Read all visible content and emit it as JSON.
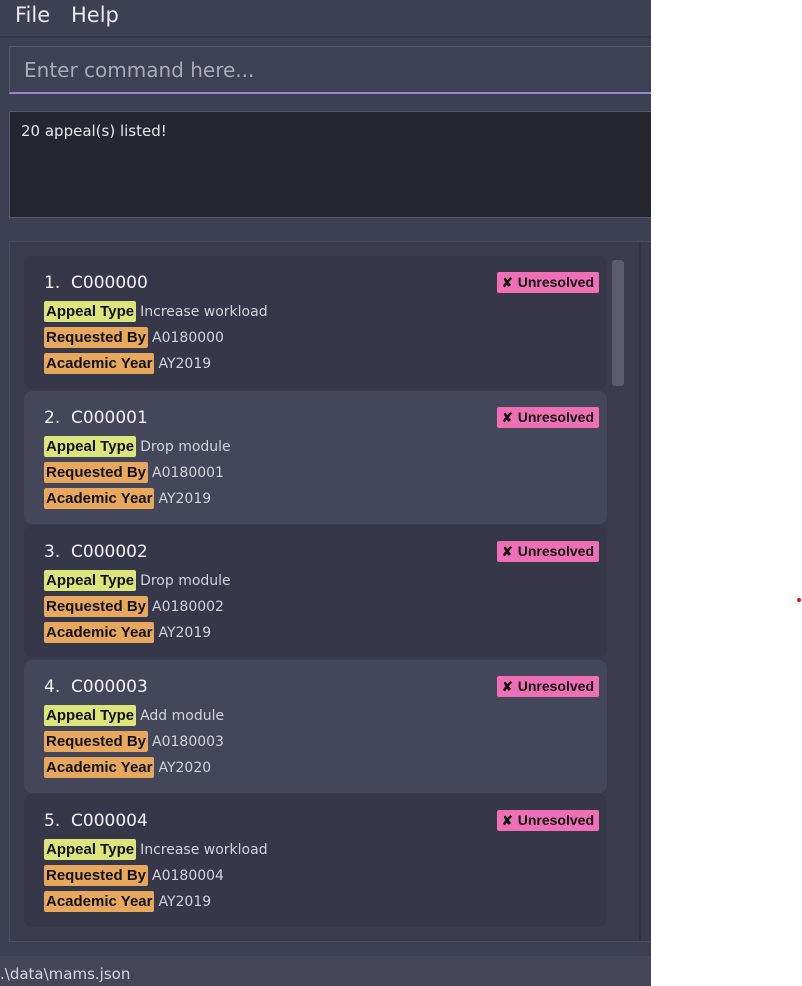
{
  "menu": {
    "file_label": "File",
    "help_label": "Help"
  },
  "command": {
    "placeholder": "Enter command here..."
  },
  "result": {
    "text": "20 appeal(s) listed!"
  },
  "labels": {
    "appeal_type": "Appeal Type",
    "requested_by": "Requested By",
    "academic_year": "Academic Year"
  },
  "status_icon": "✘",
  "appeals": [
    {
      "title": "1.  C000000",
      "status": "Unresolved",
      "appeal_type": "Increase workload",
      "requested_by": "A0180000",
      "academic_year": "AY2019"
    },
    {
      "title": "2.  C000001",
      "status": "Unresolved",
      "appeal_type": "Drop module",
      "requested_by": "A0180001",
      "academic_year": "AY2019"
    },
    {
      "title": "3.  C000002",
      "status": "Unresolved",
      "appeal_type": "Drop module",
      "requested_by": "A0180002",
      "academic_year": "AY2019"
    },
    {
      "title": "4.  C000003",
      "status": "Unresolved",
      "appeal_type": "Add module",
      "requested_by": "A0180003",
      "academic_year": "AY2020"
    },
    {
      "title": "5.  C000004",
      "status": "Unresolved",
      "appeal_type": "Increase workload",
      "requested_by": "A0180004",
      "academic_year": "AY2019"
    }
  ],
  "status_bar": {
    "path": ".\\data\\mams.json"
  },
  "colors": {
    "background": "#3d3f52",
    "result_bg": "#25262f",
    "badge_unresolved": "#ef6fb6",
    "tag_appeal_type": "#dbe57c",
    "tag_requested_by": "#e7a75c",
    "tag_academic_year": "#e7a75c"
  }
}
